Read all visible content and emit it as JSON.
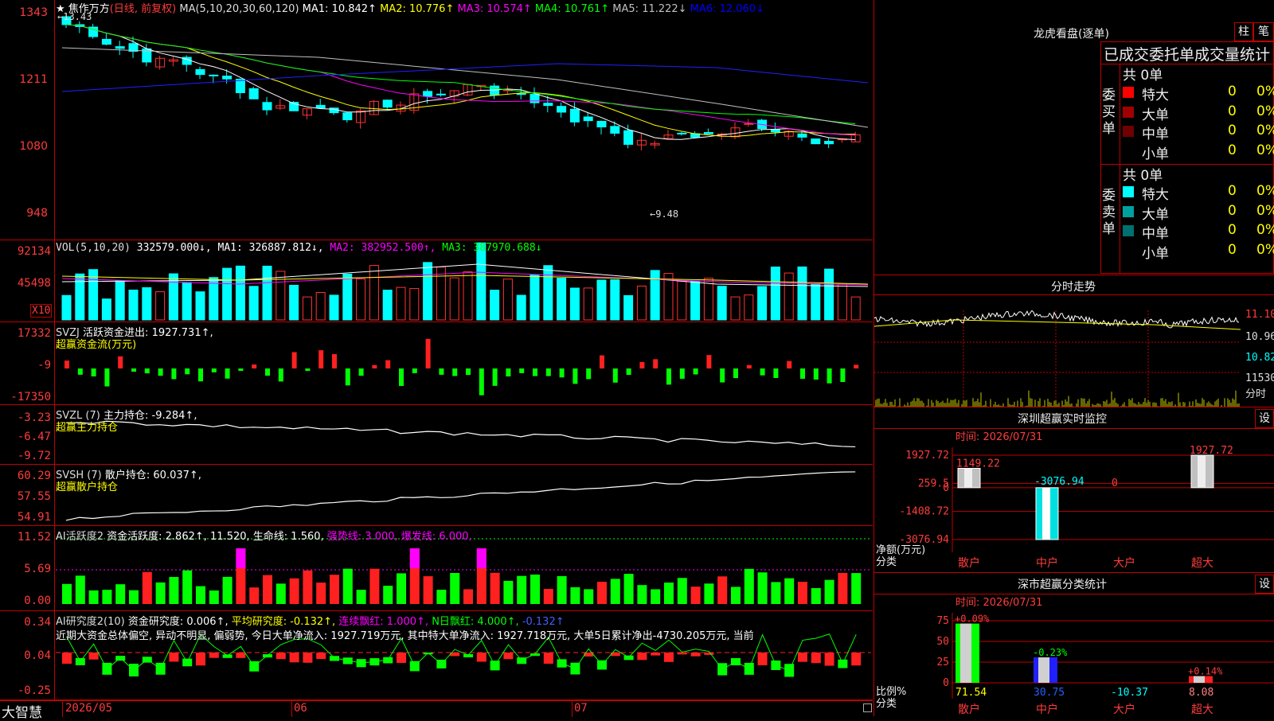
{
  "main": {
    "title": "★ 焦作万方",
    "period": "(日线, 前复权)",
    "ma_label": "MA(5,10,20,30,60,120)",
    "ma": [
      {
        "label": "MA1:",
        "value": "10.842↑",
        "color": "#ffffff"
      },
      {
        "label": "MA2:",
        "value": "10.776↑",
        "color": "#ffff00"
      },
      {
        "label": "MA3:",
        "value": "10.574↑",
        "color": "#ff00ff"
      },
      {
        "label": "MA4:",
        "value": "10.761↑",
        "color": "#00ff00"
      },
      {
        "label": "MA5:",
        "value": "11.222↓",
        "color": "#c0c0c0"
      },
      {
        "label": "MA6:",
        "value": "12.060↓",
        "color": "#0000ff"
      }
    ],
    "y_ticks": [
      "1343",
      "1211",
      "1080",
      "948"
    ],
    "high_label": "13.43",
    "low_label": "9.48"
  },
  "vol": {
    "legend_head": "VOL(5,10,20)",
    "legend_value": "332579.000↓,",
    "ma": [
      {
        "label": "MA1:",
        "value": "326887.812↓,",
        "color": "#ffffff"
      },
      {
        "label": "MA2:",
        "value": "382952.500↑,",
        "color": "#ff00ff"
      },
      {
        "label": "MA3:",
        "value": "387970.688↓",
        "color": "#00ff00"
      }
    ],
    "y_ticks": [
      "92134",
      "45498"
    ],
    "unit": "X10"
  },
  "svzj": {
    "name": "SVZJ",
    "desc": "活跃资金进出:",
    "value": "1927.731↑,",
    "sub": "超赢资金流(万元)",
    "y_ticks": [
      "17332",
      "-9",
      "-17350"
    ]
  },
  "svzl": {
    "name": "SVZL (7)",
    "desc": "主力持仓:",
    "value": "-9.284↑,",
    "sub": "超赢主力持仓",
    "y_ticks": [
      "-3.23",
      "-6.47",
      "-9.72"
    ]
  },
  "svsh": {
    "name": "SVSH (7)",
    "desc": "散户持仓:",
    "value": "60.037↑,",
    "sub": "超赢散户持仓",
    "y_ticks": [
      "60.29",
      "57.55",
      "54.91"
    ]
  },
  "ai2": {
    "name": "AI活跃度2",
    "parts": [
      {
        "text": "资金活跃度: 2.862↑,",
        "color": "#ffffff"
      },
      {
        "text": "11.520,",
        "color": "#ffffff"
      },
      {
        "text": "生命线: 1.560,",
        "color": "#ffffff"
      },
      {
        "text": "强势线: 3.000,",
        "color": "#ff00ff"
      },
      {
        "text": "爆发线: 6.000,",
        "color": "#ff00ff"
      }
    ],
    "y_ticks": [
      "11.52",
      "5.69",
      "0.00"
    ]
  },
  "ai_research": {
    "name": "AI研究度2(10)",
    "parts": [
      {
        "text": "资金研究度: 0.006↑,",
        "color": "#ffffff"
      },
      {
        "text": "平均研究度: -0.132↑,",
        "color": "#ffff00"
      },
      {
        "text": "连续飘红: 1.000↑,",
        "color": "#ff00ff"
      },
      {
        "text": "N日飘红: 4.000↑,",
        "color": "#00ff00"
      },
      {
        "text": "-0.132↑",
        "color": "#4060ff"
      }
    ],
    "comment": "近期大资金总体偏空, 异动不明显, 偏弱势, 今日大单净流入: 1927.719万元, 其中特大单净流入: 1927.718万元, 大单5日累计净出-4730.205万元, 当前",
    "y_ticks": [
      "0.34",
      "0.04",
      "-0.25"
    ]
  },
  "date_axis": {
    "brand": "大智慧",
    "labels": [
      "2026/05",
      "06",
      "07"
    ]
  },
  "dragon": {
    "title": "龙虎看盘(逐单)",
    "tab_bar": "柱",
    "tab_lines": "笔",
    "subtitle": "已成交委托单成交量统计",
    "buy_side": "委买单",
    "sell_side": "委卖单",
    "buy_total": "共 0单",
    "sell_total": "共 0单",
    "buy_rows": [
      {
        "label": "特大",
        "count": "0",
        "pct": "0%",
        "color": "#ff0000"
      },
      {
        "label": "大单",
        "count": "0",
        "pct": "0%",
        "color": "#a00000"
      },
      {
        "label": "中单",
        "count": "0",
        "pct": "0%",
        "color": "#700000"
      },
      {
        "label": "小单",
        "count": "0",
        "pct": "0%",
        "color": "#000000"
      }
    ],
    "sell_rows": [
      {
        "label": "特大",
        "count": "0",
        "pct": "0%",
        "color": "#00ffff"
      },
      {
        "label": "大单",
        "count": "0",
        "pct": "0%",
        "color": "#00a0a0"
      },
      {
        "label": "中单",
        "count": "0",
        "pct": "0%",
        "color": "#007070"
      },
      {
        "label": "小单",
        "count": "0",
        "pct": "0%",
        "color": "#000000"
      }
    ]
  },
  "timeshare": {
    "title": "分时走势",
    "y_labels": [
      "11.10",
      "10.96",
      "10.82",
      "11530"
    ],
    "footer": "分时"
  },
  "sz_monitor": {
    "title": "深圳超赢实时监控",
    "settings": "设",
    "time": "时间: 2026/07/31",
    "y_ticks": [
      "1927.72",
      "259.5",
      "0",
      "-1408.72",
      "-3076.94"
    ],
    "axis_label": "净额(万元)",
    "category_axis": "分类",
    "categories": [
      "散户",
      "中户",
      "大户",
      "超大"
    ],
    "values": [
      1149.22,
      -3076.94,
      0,
      1927.72
    ],
    "value_labels": [
      "1149.22",
      "-3076.94",
      "0",
      "1927.72"
    ]
  },
  "sz_classify": {
    "title": "深市超赢分类统计",
    "settings": "设",
    "time": "时间: 2026/07/31",
    "y_ticks": [
      "75",
      "50",
      "25",
      "0"
    ],
    "axis_label": "比例%",
    "category_axis": "分类",
    "categories": [
      "散户",
      "中户",
      "大户",
      "超大"
    ],
    "bar_values": [
      71.54,
      30.75,
      0,
      8.08
    ],
    "pct_labels": [
      "+0.09%",
      "-0.23%",
      "",
      "+0.14%"
    ],
    "bottom_values": [
      "71.54",
      "30.75",
      "-10.37",
      "8.08"
    ]
  },
  "chart_data": {
    "type": "table",
    "note_series": [
      {
        "name": "深圳超赢实时监控",
        "categories": [
          "散户",
          "中户",
          "大户",
          "超大"
        ],
        "values": [
          1149.22,
          -3076.94,
          0,
          1927.72
        ]
      },
      {
        "name": "深市超赢分类统计",
        "categories": [
          "散户",
          "中户",
          "大户",
          "超大"
        ],
        "values": [
          71.54,
          30.75,
          -10.37,
          8.08
        ]
      }
    ]
  }
}
